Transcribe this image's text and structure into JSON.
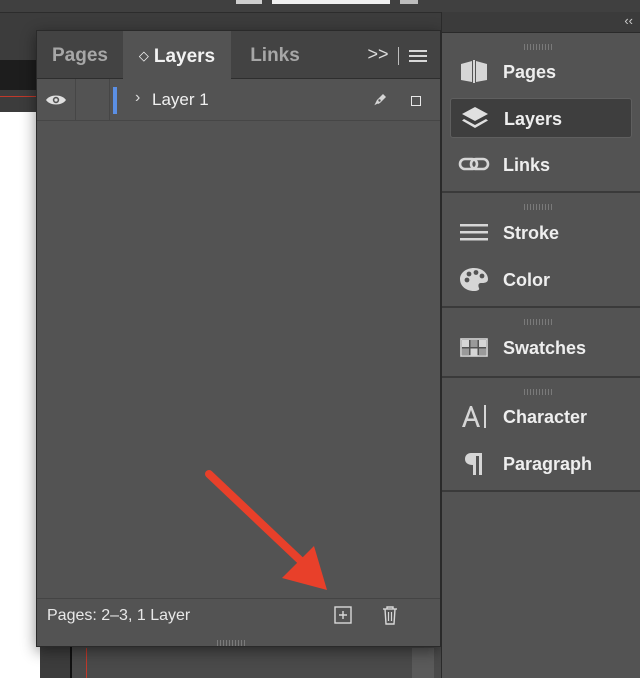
{
  "panel": {
    "tabs": [
      {
        "label": "Pages"
      },
      {
        "label": "Layers",
        "active": true
      },
      {
        "label": "Links"
      }
    ],
    "collapse_glyph": ">>",
    "layers": [
      {
        "name": "Layer 1",
        "visible": true,
        "color": "#5b8fe4"
      }
    ],
    "status": "Pages: 2–3, 1 Layer"
  },
  "dock": {
    "collapse_glyph": "‹‹",
    "items": [
      {
        "label": "Pages",
        "icon": "pages-icon"
      },
      {
        "label": "Layers",
        "icon": "layers-icon",
        "active": true
      },
      {
        "label": "Links",
        "icon": "links-icon"
      },
      {
        "label": "Stroke",
        "icon": "stroke-icon"
      },
      {
        "label": "Color",
        "icon": "color-palette-icon"
      },
      {
        "label": "Swatches",
        "icon": "swatches-icon"
      },
      {
        "label": "Character",
        "icon": "character-icon"
      },
      {
        "label": "Paragraph",
        "icon": "paragraph-icon"
      }
    ]
  },
  "annotation": {
    "color": "#e8402a",
    "points_to": "new-layer-button"
  }
}
